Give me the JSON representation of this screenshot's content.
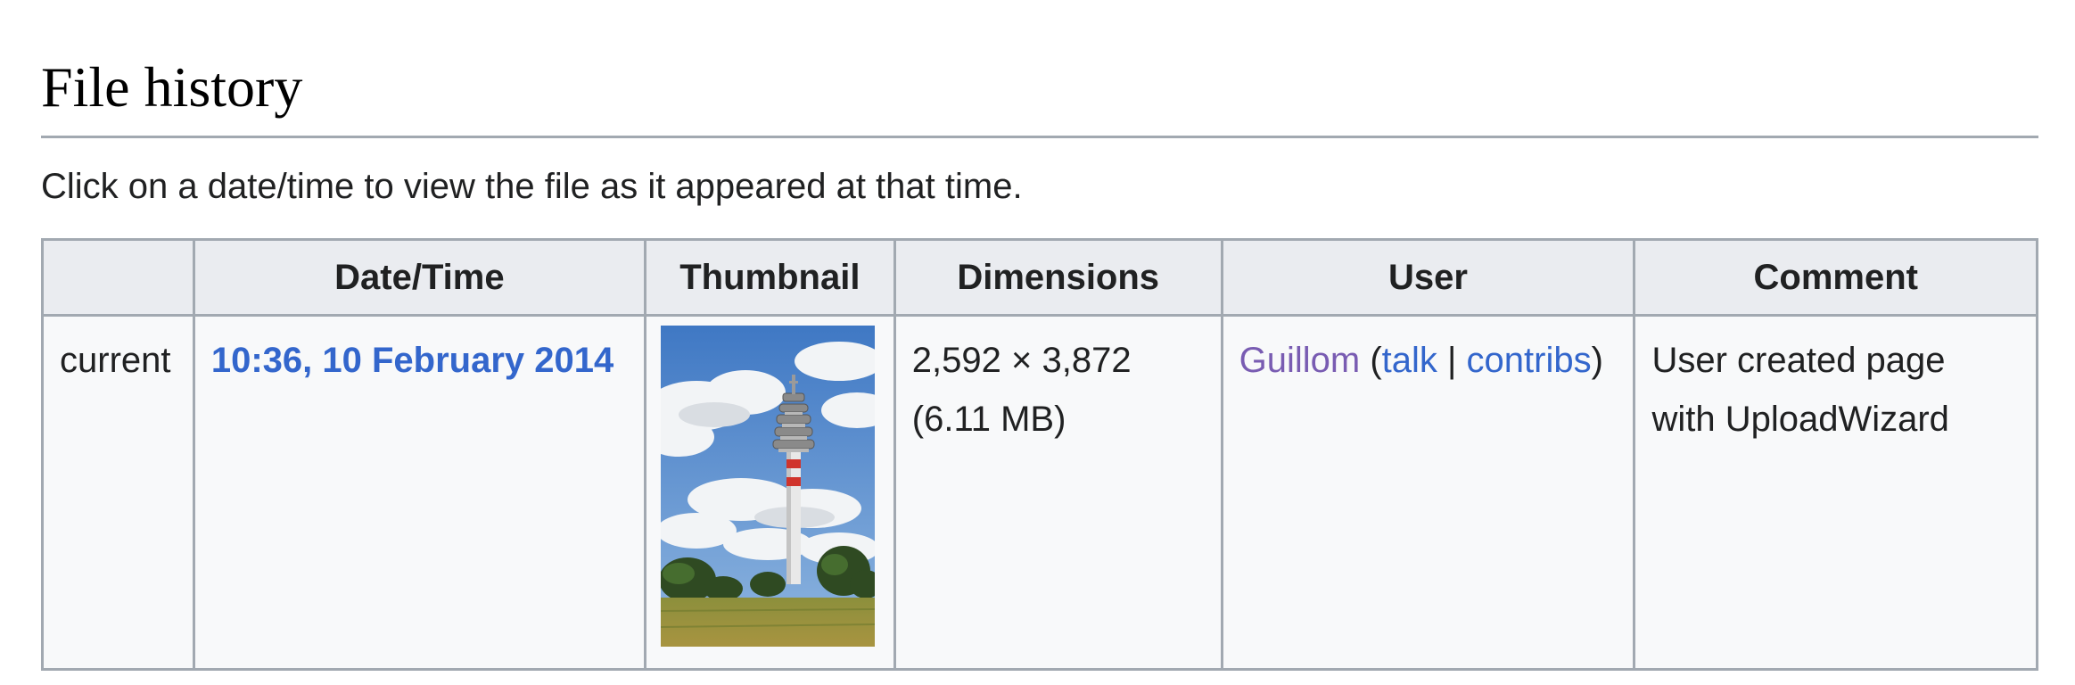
{
  "section": {
    "title": "File history",
    "intro": "Click on a date/time to view the file as it appeared at that time."
  },
  "table": {
    "headers": {
      "status": "",
      "datetime": "Date/Time",
      "thumbnail": "Thumbnail",
      "dimensions": "Dimensions",
      "user": "User",
      "comment": "Comment"
    },
    "rows": [
      {
        "status": "current",
        "datetime": "10:36, 10 February 2014",
        "thumbnail_icon": "tower-photo-thumbnail",
        "dimensions_line1": "2,592 × 3,872",
        "dimensions_line2": "(6.11 MB)",
        "user_name": "Guillom",
        "user_open_paren": "(",
        "user_talk": "talk",
        "user_separator": " | ",
        "user_contribs": "contribs",
        "user_close_paren": ")",
        "comment_line1": "User created page",
        "comment_line2": "with UploadWizard"
      }
    ]
  },
  "colors": {
    "link": "#3366cc",
    "visited_link": "#795cb2",
    "header_bg": "#eaecf0",
    "cell_bg": "#f8f9fa",
    "border": "#a2a9b1"
  }
}
